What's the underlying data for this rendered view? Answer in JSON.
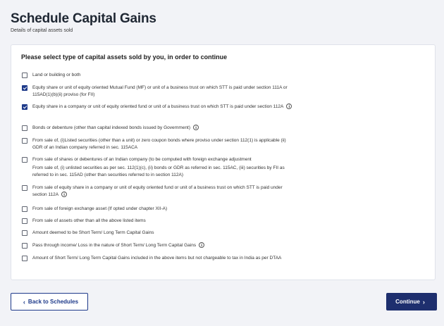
{
  "header": {
    "title": "Schedule Capital Gains",
    "subtitle": "Details of capital assets sold"
  },
  "card": {
    "heading": "Please select type of capital assets sold by you, in order to continue",
    "options": [
      {
        "label": "Land or building or both",
        "checked": false
      },
      {
        "label": "Equity share or unit of equity oriented Mutual Fund (MF) or unit of a business trust on which STT is paid under section 111A or 115AD(1)(b)(ii) proviso (for FII)",
        "checked": true
      },
      {
        "label": "Equity share in a company or unit of equity oriented fund or unit of a business trust on which STT is paid under section 112A",
        "checked": true
      },
      {
        "label": "Bonds or debenture (other than capital indexed bonds issued by Government)",
        "checked": false
      },
      {
        "label": "From sale of, (i)Listed securities (other than a unit) or zero coupon bonds where proviso under section 112(1) is applicable (ii) GDR of an Indian company referred in sec. 115ACA",
        "checked": false
      },
      {
        "label": "From sale of shares or debentures of an Indian company (to be computed with foreign exchange adjustment",
        "checked": false
      },
      {
        "label": "From sale of, (i) unlisted securities as per sec. 112(1)(c), (ii) bonds or GDR as referred in sec. 115AC, (iii) securities by FII as referred to in sec. 115AD (other than securities referred to in section 112A)",
        "checked": false
      },
      {
        "label": "From sale of equity share in a company or unit of equity oriented fund or unit of a business trust on which STT is paid under section 112A",
        "checked": false
      },
      {
        "label": "From sale of foreign exchange asset (If opted under chapter XII-A)",
        "checked": false
      },
      {
        "label": "From sale of assets other than all the above listed items",
        "checked": false
      },
      {
        "label": "Amount deemed to be Short Term/ Long Term Capital Gains",
        "checked": false
      },
      {
        "label": "Pass through income/ Loss in the nature of Short Term/ Long Term Capital Gains",
        "checked": false
      },
      {
        "label": "Amount of Short Term/ Long Term Capital Gains included in the above items but not chargeable to tax in India as per DTAA",
        "checked": false
      }
    ]
  },
  "footer": {
    "back_label": "Back to Schedules",
    "continue_label": "Continue"
  },
  "icons": {
    "info": "info-icon",
    "chevron_left": "chevron-left-icon",
    "chevron_right": "chevron-right-icon"
  },
  "colors": {
    "primary": "#1e2f6e",
    "checkbox_checked": "#1e3a8a",
    "background": "#f2f3f7"
  }
}
